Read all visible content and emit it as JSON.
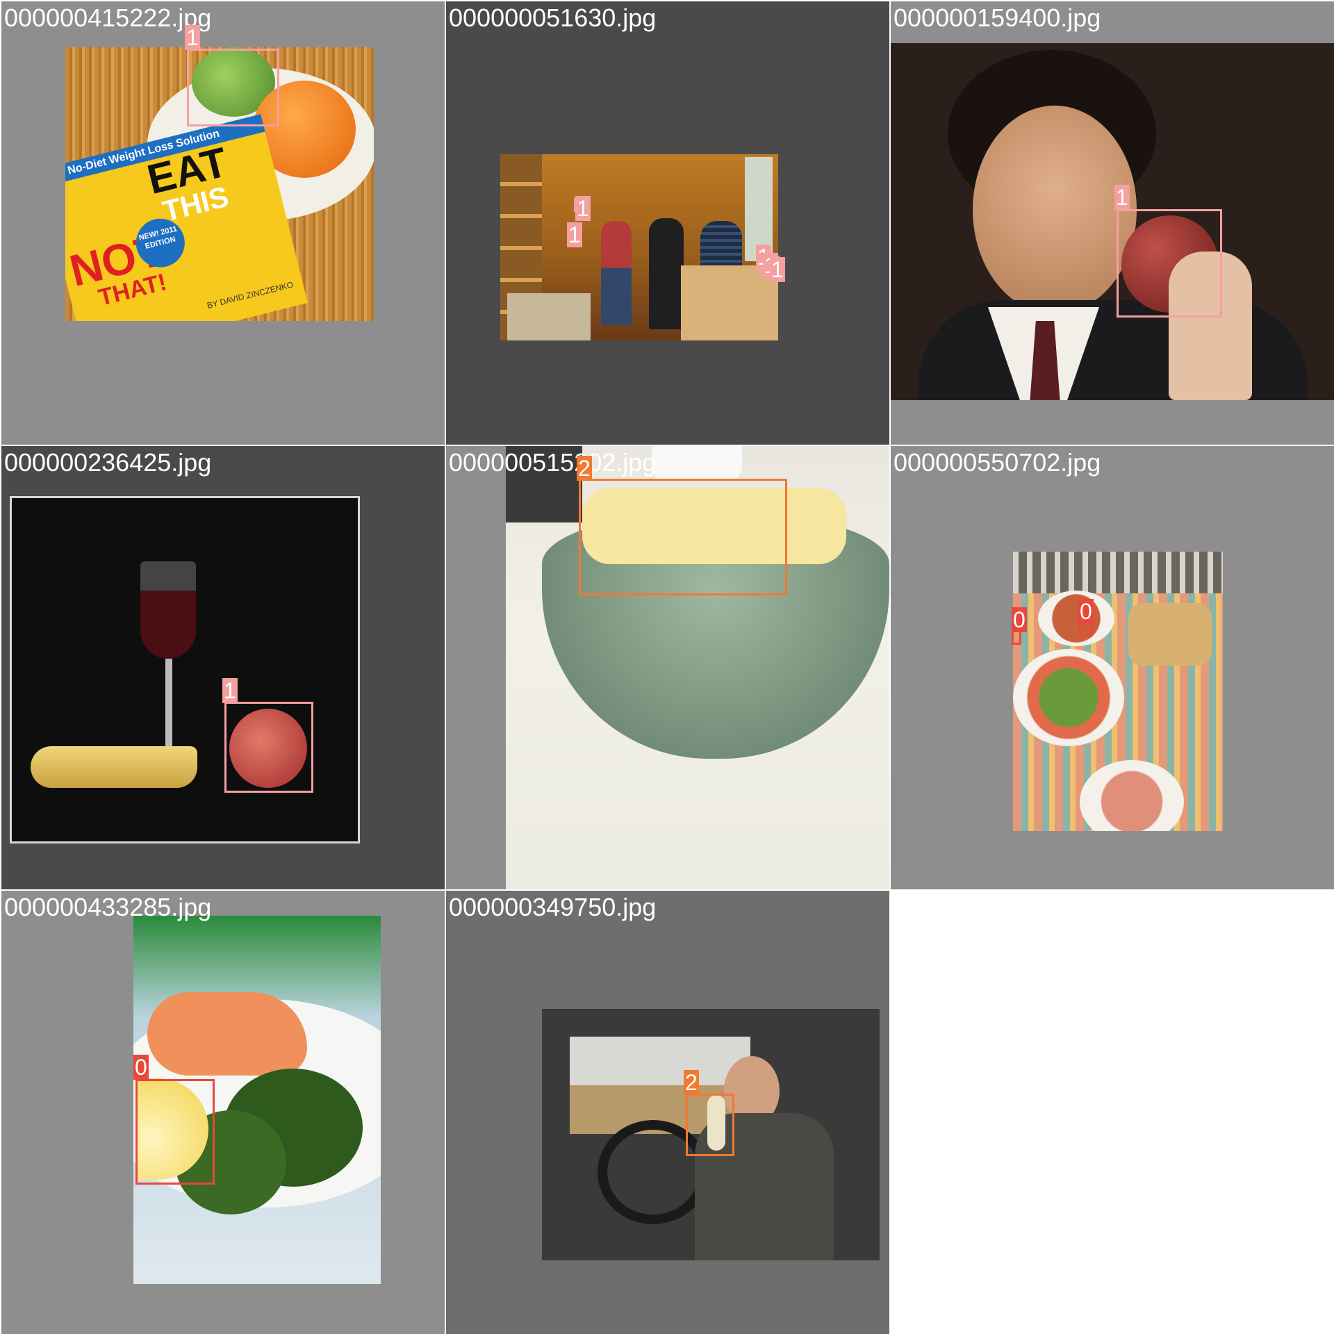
{
  "class_colors": {
    "0": "#e8483a",
    "1": "#f4a0a0",
    "2": "#f07a30"
  },
  "tiles": [
    {
      "filename": "000000415222.jpg",
      "labels": [
        "1"
      ]
    },
    {
      "filename": "000000051630.jpg",
      "labels": [
        "1",
        "1",
        "1",
        "1",
        "1"
      ]
    },
    {
      "filename": "000000159400.jpg",
      "labels": [
        "1"
      ]
    },
    {
      "filename": "000000236425.jpg",
      "labels": [
        "1"
      ]
    },
    {
      "filename": "000000515202.jpg",
      "labels": [
        "2"
      ]
    },
    {
      "filename": "000000550702.jpg",
      "labels": [
        "0",
        "0"
      ]
    },
    {
      "filename": "000000433285.jpg",
      "labels": [
        "0"
      ]
    },
    {
      "filename": "000000349750.jpg",
      "labels": [
        "2"
      ]
    }
  ],
  "magazine": {
    "banner": "The No-Diet Weight Loss Solution",
    "title_line1": "EAT",
    "title_line2": "THIS",
    "title_line3": "NOT",
    "title_line4": "THAT!",
    "badge": "NEW! 2011 EDITION",
    "byline": "BY DAVID ZINCZENKO"
  }
}
